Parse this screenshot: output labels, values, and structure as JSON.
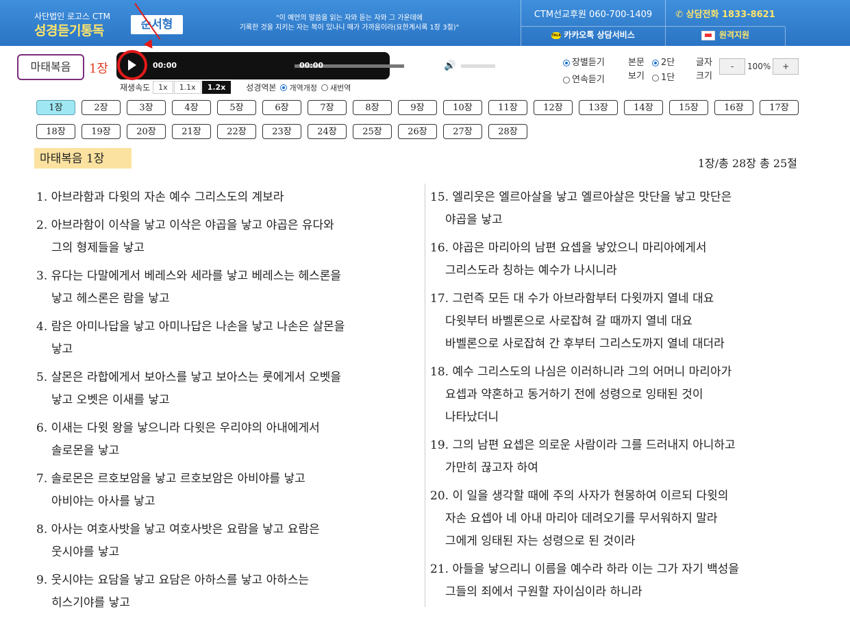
{
  "header": {
    "org": "사단법인 로고스 CTM",
    "site_name": "성경듣기통독",
    "mode_badge": "순서형",
    "quote_line1": "\"이 예언의 말씀을 읽는 자와 듣는 자와 그 가운데에",
    "quote_line2": "기록한 것을 지키는 자는 복이 있나니 때가 가까움이라(요한계시록 1장 3절)\"",
    "support_phone": "CTM선교후원 060-700-1409",
    "counsel_phone": "상담전화 1833-8621",
    "kakao": "카카오톡 상담서비스",
    "remote": "원격지원"
  },
  "book": {
    "name": "마태복음",
    "chapter_label": "1장"
  },
  "player": {
    "current_time": "00:00",
    "duration": "00:00",
    "progress": 0
  },
  "playback": {
    "speed_label": "재생속도",
    "speeds": [
      "1x",
      "1.1x",
      "1.2x"
    ],
    "active_speed": "1.2x",
    "version_label": "성경역본",
    "versions": [
      "개역개정",
      "새번역"
    ],
    "selected_version": "개역개정"
  },
  "options": {
    "listen_by_chapter": "장별듣기",
    "listen_continuous": "연속듣기",
    "view_label_1": "본문",
    "view_label_2": "보기",
    "col2": "2단",
    "col1": "1단",
    "font_label_1": "글자",
    "font_label_2": "크기",
    "font_minus": "-",
    "font_size": "100%",
    "font_plus": "+"
  },
  "chapters": [
    "1장",
    "2장",
    "3장",
    "4장",
    "5장",
    "6장",
    "7장",
    "8장",
    "9장",
    "10장",
    "11장",
    "12장",
    "13장",
    "14장",
    "15장",
    "16장",
    "17장",
    "18장",
    "19장",
    "20장",
    "21장",
    "22장",
    "23장",
    "24장",
    "25장",
    "26장",
    "27장",
    "28장"
  ],
  "active_chapter": "1장",
  "content": {
    "title": "마태복음  1장",
    "counts": "1장/총 28장   총 25절"
  },
  "verses_left": [
    {
      "num": "1.",
      "l1": "아브라함과 다윗의 자손 예수 그리스도의 계보라",
      "l2": ""
    },
    {
      "num": "2.",
      "l1": "아브라함이 이삭을 낳고 이삭은 야곱을 낳고 야곱은 유다와",
      "l2": "그의 형제들을 낳고"
    },
    {
      "num": "3.",
      "l1": "유다는 다말에게서 베레스와 세라를 낳고 베레스는 헤스론을",
      "l2": "낳고 헤스론은 람을 낳고"
    },
    {
      "num": "4.",
      "l1": "람은 아미나답을 낳고 아미나답은 나손을 낳고 나손은 살몬을",
      "l2": "낳고"
    },
    {
      "num": "5.",
      "l1": "살몬은 라합에게서 보아스를 낳고 보아스는 룻에게서 오벳을",
      "l2": "낳고 오벳은 이새를 낳고"
    },
    {
      "num": "6.",
      "l1": "이새는 다윗 왕을 낳으니라 다윗은 우리야의 아내에게서",
      "l2": "솔로몬을 낳고"
    },
    {
      "num": "7.",
      "l1": "솔로몬은 르호보암을 낳고 르호보암은 아비야를 낳고",
      "l2": "아비야는 아사를 낳고"
    },
    {
      "num": "8.",
      "l1": "아사는 여호사밧을 낳고 여호사밧은 요람을 낳고 요람은",
      "l2": "웃시야를 낳고"
    },
    {
      "num": "9.",
      "l1": "웃시야는 요담을 낳고 요담은 아하스를 낳고 아하스는",
      "l2": "히스기야를 낳고"
    }
  ],
  "verses_right": [
    {
      "num": "15.",
      "l1": "엘리웃은 엘르아살을 낳고 엘르아살은 맛단을 낳고 맛단은",
      "l2": "야곱을 낳고",
      "l3": ""
    },
    {
      "num": "16.",
      "l1": "야곱은 마리아의 남편 요셉을 낳았으니 마리아에게서",
      "l2": "그리스도라 칭하는 예수가 나시니라",
      "l3": ""
    },
    {
      "num": "17.",
      "l1": "그런즉 모든 대 수가 아브라함부터 다윗까지 열네 대요",
      "l2": "다윗부터 바벨론으로 사로잡혀 갈 때까지 열네 대요",
      "l3": "바벨론으로 사로잡혀 간 후부터 그리스도까지 열네 대더라"
    },
    {
      "num": "18.",
      "l1": "예수 그리스도의 나심은 이러하니라 그의 어머니 마리아가",
      "l2": "요셉과 약혼하고 동거하기 전에 성령으로 잉태된 것이",
      "l3": "나타났더니"
    },
    {
      "num": "19.",
      "l1": "그의 남편 요셉은 의로운 사람이라 그를 드러내지 아니하고",
      "l2": "가만히 끊고자 하여",
      "l3": ""
    },
    {
      "num": "20.",
      "l1": "이 일을 생각할 때에 주의 사자가 현몽하여 이르되 다윗의",
      "l2": "자손 요셉아 네 아내 마리아 데려오기를 무서워하지 말라",
      "l3": "그에게 잉태된 자는 성령으로 된 것이라"
    },
    {
      "num": "21.",
      "l1": "아들을 낳으리니 이름을 예수라 하라 이는 그가 자기 백성을",
      "l2": "그들의 죄에서 구원할 자이심이라 하니라",
      "l3": ""
    }
  ]
}
